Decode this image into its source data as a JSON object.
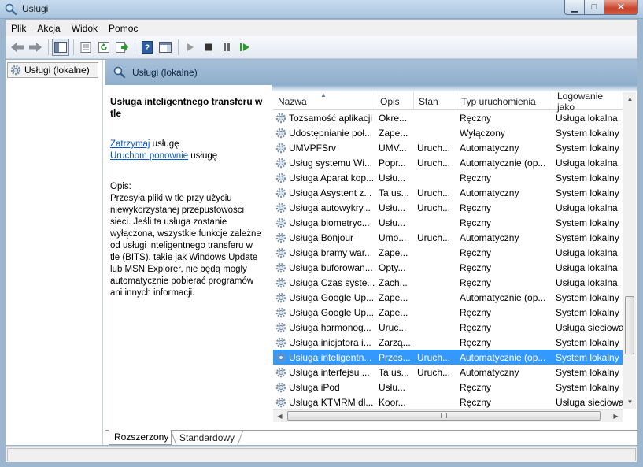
{
  "window": {
    "title": "Usługi"
  },
  "menu": {
    "items": [
      "Plik",
      "Akcja",
      "Widok",
      "Pomoc"
    ]
  },
  "tree": {
    "item": "Usługi (lokalne)"
  },
  "panel": {
    "title": "Usługi (lokalne)"
  },
  "description": {
    "title": "Usługa inteligentnego transferu w tle",
    "stop_link": "Zatrzymaj",
    "stop_suffix": " usługę",
    "restart_link": "Uruchom ponownie",
    "restart_suffix": " usługę",
    "opis_label": "Opis:",
    "opis_text": "Przesyła pliki w tle przy użyciu niewykorzystanej przepustowości sieci. Jeśli ta usługa zostanie wyłączona, wszystkie funkcje zależne od usługi inteligentnego transferu w tle (BITS), takie jak Windows Update lub MSN Explorer, nie będą mogły automatycznie pobierać programów ani innych informacji."
  },
  "table": {
    "columns": [
      "Nazwa",
      "Opis",
      "Stan",
      "Typ uruchomienia",
      "Logowanie jako"
    ],
    "rows": [
      [
        "Tożsamość aplikacji",
        "Okre...",
        "",
        "Ręczny",
        "Usługa lokalna"
      ],
      [
        "Udostępnianie poł...",
        "Zape...",
        "",
        "Wyłączony",
        "System lokalny"
      ],
      [
        "UMVPFSrv",
        "UMV...",
        "Uruch...",
        "Automatyczny",
        "System lokalny"
      ],
      [
        "Usług systemu Wi...",
        "Popr...",
        "Uruch...",
        "Automatycznie (op...",
        "Usługa lokalna"
      ],
      [
        "Usługa Aparat kop...",
        "Usłu...",
        "",
        "Ręczny",
        "System lokalny"
      ],
      [
        "Usługa Asystent z...",
        "Ta us...",
        "Uruch...",
        "Automatyczny",
        "System lokalny"
      ],
      [
        "Usługa autowykry...",
        "Usłu...",
        "Uruch...",
        "Ręczny",
        "Usługa lokalna"
      ],
      [
        "Usługa biometryc...",
        "Usłu...",
        "",
        "Ręczny",
        "System lokalny"
      ],
      [
        "Usługa Bonjour",
        "Umo...",
        "Uruch...",
        "Automatyczny",
        "System lokalny"
      ],
      [
        "Usługa bramy war...",
        "Zape...",
        "",
        "Ręczny",
        "Usługa lokalna"
      ],
      [
        "Usługa buforowan...",
        "Opty...",
        "",
        "Ręczny",
        "Usługa lokalna"
      ],
      [
        "Usługa Czas syste...",
        "Zach...",
        "",
        "Ręczny",
        "Usługa lokalna"
      ],
      [
        "Usługa Google Up...",
        "Zape...",
        "",
        "Automatycznie (op...",
        "System lokalny"
      ],
      [
        "Usługa Google Up...",
        "Zape...",
        "",
        "Ręczny",
        "System lokalny"
      ],
      [
        "Usługa harmonog...",
        "Uruc...",
        "",
        "Ręczny",
        "Usługa sieciowa"
      ],
      [
        "Usługa inicjatora i...",
        "Zarzą...",
        "",
        "Ręczny",
        "System lokalny"
      ],
      [
        "Usługa inteligentn...",
        "Przes...",
        "Uruch...",
        "Automatycznie (op...",
        "System lokalny"
      ],
      [
        "Usługa interfejsu ...",
        "Ta us...",
        "Uruch...",
        "Automatyczny",
        "System lokalny"
      ],
      [
        "Usługa iPod",
        "Usłu...",
        "",
        "Ręczny",
        "System lokalny"
      ],
      [
        "Usługa KTMRM dl...",
        "Koor...",
        "",
        "Ręczny",
        "Usługa sieciowa"
      ]
    ],
    "selected_index": 16
  },
  "tabs": [
    "Rozszerzony",
    "Standardowy"
  ],
  "colors": {
    "selection": "#3399ff",
    "link": "#0b55c4",
    "header": "#8eaecd"
  }
}
